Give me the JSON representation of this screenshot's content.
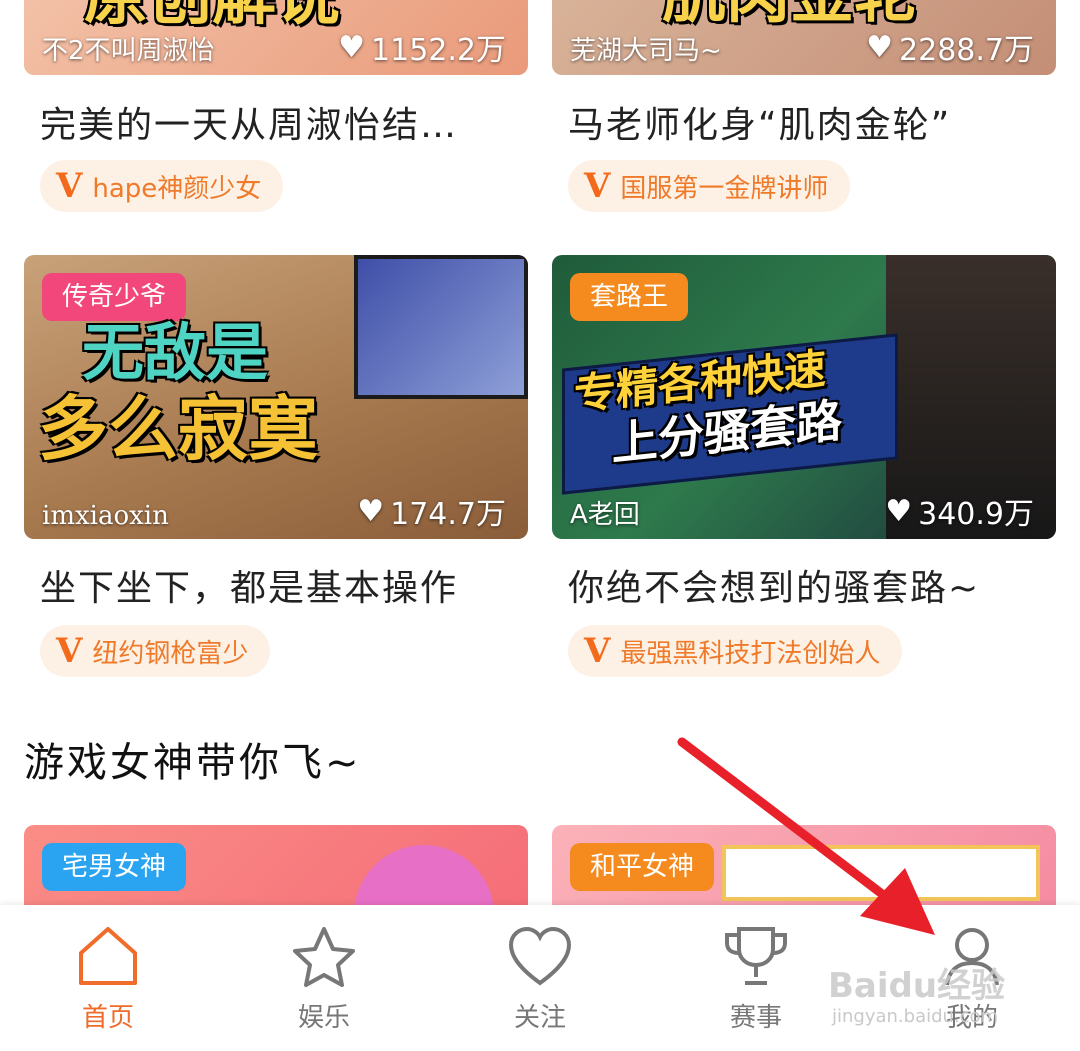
{
  "colors": {
    "accent": "#ef6c2a",
    "pill_bg": "#fdf0e4",
    "tag_pink": "#f2477a",
    "tag_orange": "#f58a1f",
    "tag_blue": "#2aa4f0",
    "arrow_red": "#e8202a"
  },
  "cards": [
    {
      "uploader": "不2不叫周淑怡",
      "likes": "1152.2万",
      "thumb_text": "原创解说",
      "title": "完美的一天从周淑怡结…",
      "anchor": "hape神颜少女"
    },
    {
      "uploader": "芜湖大司马~",
      "likes": "2288.7万",
      "thumb_text": "肌肉金轮",
      "title": "马老师化身“肌肉金轮”",
      "anchor": "国服第一金牌讲师"
    },
    {
      "tag": "传奇少爷",
      "uploader": "imxiaoxin",
      "likes": "174.7万",
      "thumb_text_1": "无敌是",
      "thumb_text_2": "多么寂寞",
      "title": "坐下坐下，都是基本操作",
      "anchor": "纽约钢枪富少"
    },
    {
      "tag": "套路王",
      "uploader": "A老回",
      "likes": "340.9万",
      "thumb_text_1": "专精各种快速",
      "thumb_text_2": "上分骚套路",
      "title": "你绝不会想到的骚套路~",
      "anchor": "最强黑科技打法创始人"
    }
  ],
  "section_title": "游戏女神带你飞~",
  "cards_next": [
    {
      "tag": "宅男女神"
    },
    {
      "tag": "和平女神"
    }
  ],
  "tabs": [
    {
      "label": "首页",
      "icon": "home-icon",
      "active": true
    },
    {
      "label": "娱乐",
      "icon": "star-icon",
      "active": false
    },
    {
      "label": "关注",
      "icon": "heart-icon",
      "active": false
    },
    {
      "label": "赛事",
      "icon": "trophy-icon",
      "active": false
    },
    {
      "label": "我的",
      "icon": "user-icon",
      "active": false
    }
  ],
  "watermark": {
    "brand": "Baidu经验",
    "url": "jingyan.baidu.com"
  }
}
